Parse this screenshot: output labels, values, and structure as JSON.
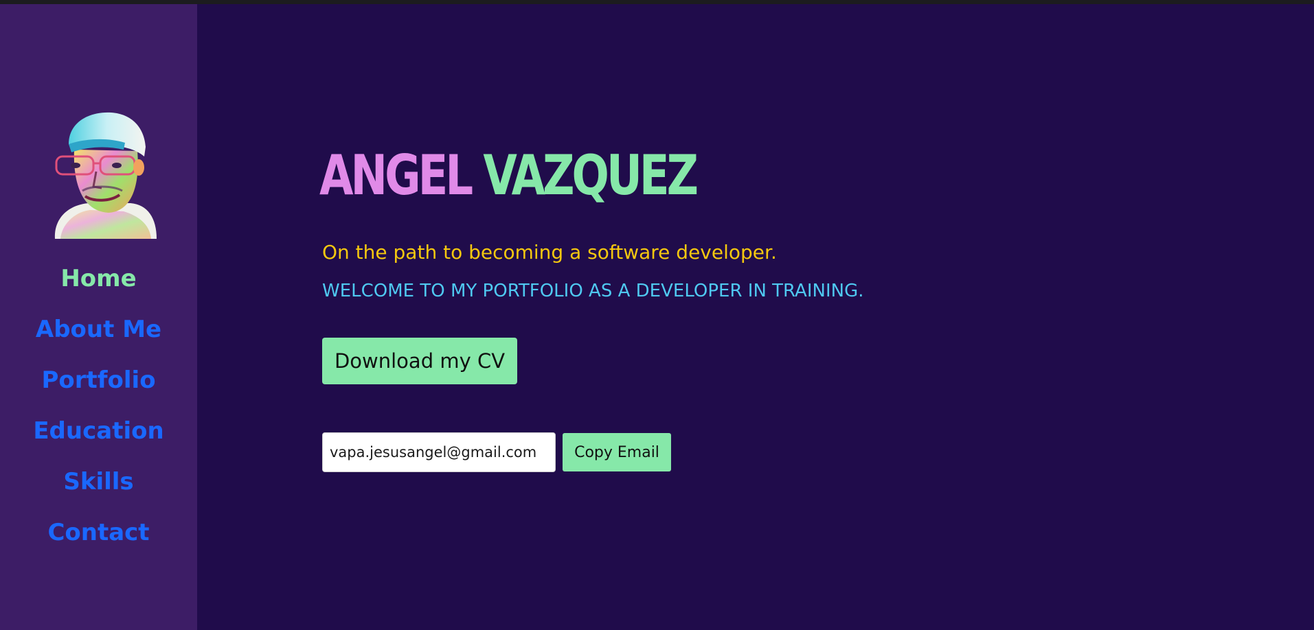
{
  "nav": {
    "items": [
      {
        "label": "Home",
        "active": true
      },
      {
        "label": "About Me",
        "active": false
      },
      {
        "label": "Portfolio",
        "active": false
      },
      {
        "label": "Education",
        "active": false
      },
      {
        "label": "Skills",
        "active": false
      },
      {
        "label": "Contact",
        "active": false
      }
    ]
  },
  "hero": {
    "first_name": "ANGEL",
    "last_name": "VAZQUEZ",
    "tagline": "On the path to becoming a software developer.",
    "welcome": "WELCOME TO MY PORTFOLIO AS A DEVELOPER IN TRAINING.",
    "cv_button_label": "Download my CV"
  },
  "contact": {
    "email_value": "vapa.jesusangel@gmail.com",
    "copy_button_label": "Copy Email"
  },
  "colors": {
    "background": "#200c4b",
    "sidebar": "#3d1d66",
    "accent_green": "#86e8a9",
    "accent_pink": "#e08ae8",
    "link_blue": "#1a68ff",
    "tagline_yellow": "#f5c80f",
    "welcome_cyan": "#4fc9f1"
  }
}
